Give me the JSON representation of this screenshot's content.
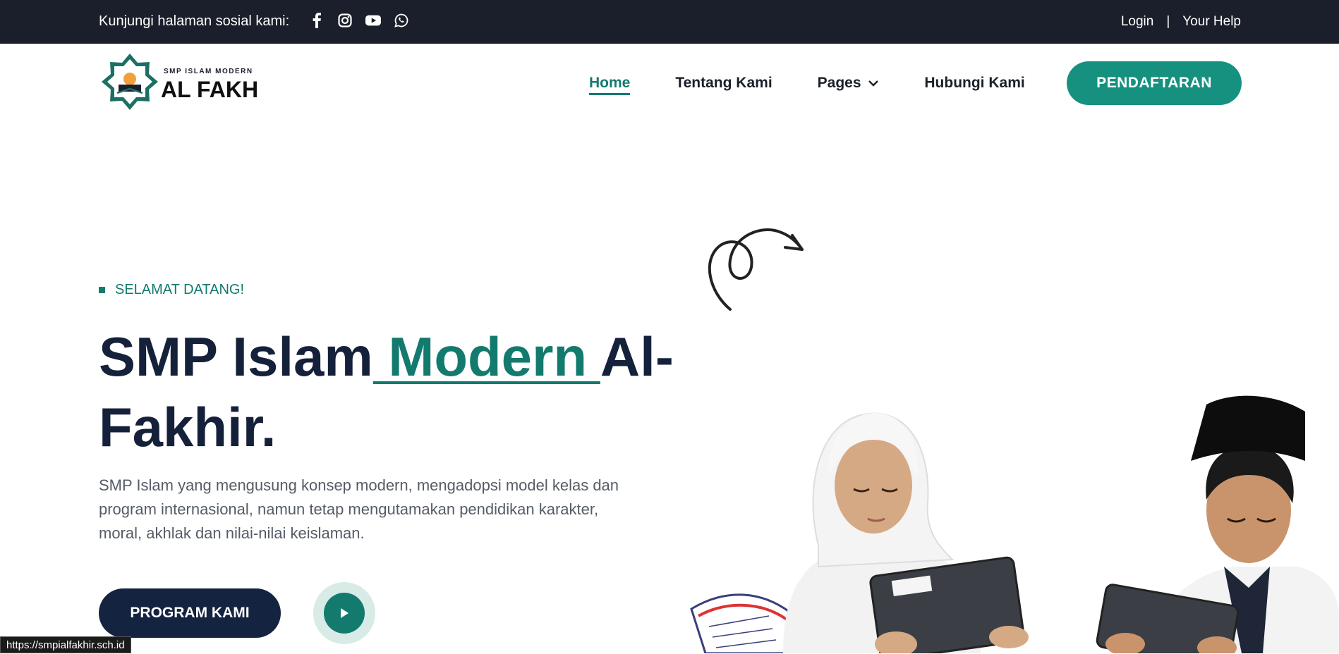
{
  "topbar": {
    "social_label": "Kunjungi halaman sosial kami:",
    "social_icons": [
      "facebook-icon",
      "instagram-icon",
      "youtube-icon",
      "whatsapp-icon"
    ],
    "login": "Login",
    "divider": "|",
    "help": "Your Help"
  },
  "logo": {
    "line1": "SMP ISLAM MODERN",
    "line2": "AL FAKHiR"
  },
  "nav": {
    "items": [
      {
        "label": "Home",
        "active": true
      },
      {
        "label": "Tentang Kami"
      },
      {
        "label": "Pages"
      },
      {
        "label": "Hubungi Kami"
      }
    ],
    "cta": "PENDAFTARAN"
  },
  "hero": {
    "eyebrow": "SELAMAT DATANG!",
    "title_part1": "SMP Islam",
    "title_accent": " Modern ",
    "title_part2": "Al-Fakhir.",
    "description": "SMP Islam yang mengusung konsep modern, mengadopsi model kelas dan program internasional, namun tetap mengutamakan pendidikan karakter, moral, akhlak dan nilai-nilai keislaman.",
    "button": "PROGRAM KAMI"
  },
  "status_url": "https://smpialfakhir.sch.id",
  "colors": {
    "accent": "#137a6e",
    "cta": "#16917f",
    "dark": "#142440",
    "topbar": "#1a1f2b"
  }
}
